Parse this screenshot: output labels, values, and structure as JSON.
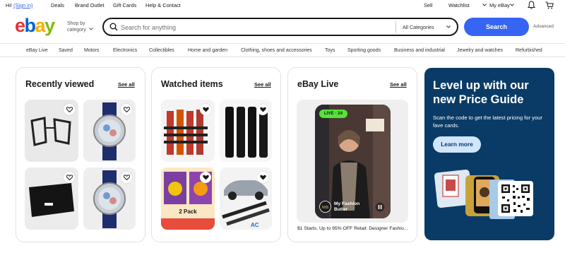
{
  "topbar": {
    "greeting": "Hi!",
    "sign_in": "(Sign in)",
    "deals": "Deals",
    "brand_outlet": "Brand Outlet",
    "gift_cards": "Gift Cards",
    "help_contact": "Help & Contact",
    "sell": "Sell",
    "watchlist": "Watchlist",
    "my_ebay": "My eBay"
  },
  "header": {
    "logo": {
      "e": "e",
      "b": "b",
      "a": "a",
      "y": "y"
    },
    "shop_by_line1": "Shop by",
    "shop_by_line2": "category",
    "search_placeholder": "Search for anything",
    "category_select": "All Categories",
    "search_button": "Search",
    "advanced": "Advanced"
  },
  "categories": [
    "eBay Live",
    "Saved",
    "Motors",
    "Electronics",
    "Collectibles",
    "Home and garden",
    "Clothing, shoes and accessories",
    "Toys",
    "Sporting goods",
    "Business and industrial",
    "Jewelry and watches",
    "Refurbished"
  ],
  "recently_viewed": {
    "title": "Recently viewed",
    "see_all": "See all"
  },
  "watched_items": {
    "title": "Watched items",
    "see_all": "See all",
    "pack_label": "2 Pack"
  },
  "ebay_live": {
    "title": "eBay Live",
    "see_all": "See all",
    "badge": "LIVE · 24",
    "channel_line1": "My Fashion",
    "channel_line2": "Butler",
    "caption": "$1 Starts, Up to 95% OFF Retail: Designer Fashio..."
  },
  "promo": {
    "title": "Level up with our new Price Guide",
    "body": "Scan the code to get the latest pricing for your fave cards.",
    "button": "Learn more"
  },
  "colors": {
    "accent": "#3665f3",
    "promo_bg": "#0a3b66",
    "live_badge": "#56e33a"
  }
}
